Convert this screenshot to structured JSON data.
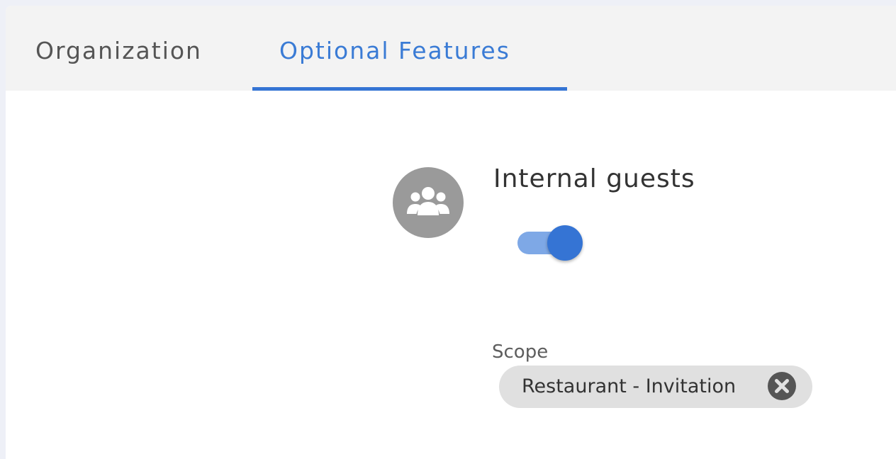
{
  "tabs": [
    {
      "label": "Organization",
      "active": false
    },
    {
      "label": "Optional Features",
      "active": true
    }
  ],
  "feature": {
    "icon": "users-group-icon",
    "title": "Internal guests",
    "enabled": true
  },
  "scope": {
    "label": "Scope",
    "chips": [
      {
        "label": "Restaurant - Invitation",
        "remove_icon": "close-circle-icon"
      }
    ]
  },
  "colors": {
    "accent": "#3574d4",
    "toggle_track": "#7ea8e6",
    "avatar_bg": "#9a9a9a",
    "chip_bg": "#e0e0e0"
  }
}
